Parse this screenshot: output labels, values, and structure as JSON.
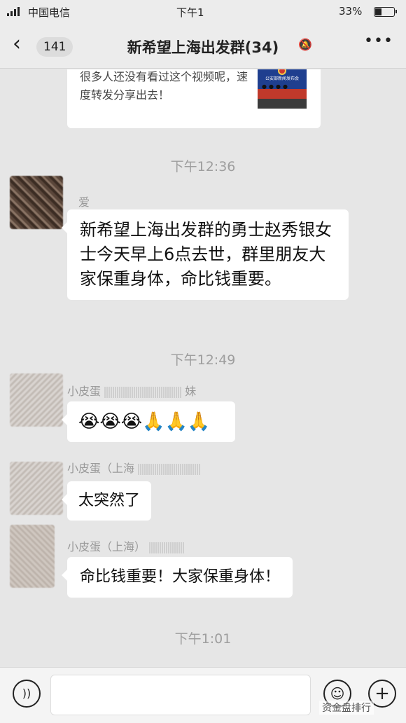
{
  "status_bar": {
    "carrier": "中国电信",
    "time": "下午1",
    "battery_pct": "33%",
    "battery_level": 0.33
  },
  "nav": {
    "back_count": "141",
    "title": "新希望上海出发群(34)"
  },
  "share_card": {
    "text": "很多人还没有看过这个视频呢，速度转发分享出去！",
    "thumb_caption": "公安部新闻发布会"
  },
  "messages": {
    "time1": "下午12:36",
    "sender1": "爱",
    "text1": "新希望上海出发群的勇士赵秀银女士今天早上6点去世，群里朋友大家保重身体，命比钱重要。",
    "time2": "下午12:49",
    "sender2": "小皮蛋",
    "sender2_suffix": "妹",
    "text2": "😭😭😭🙏🙏🙏",
    "sender3": "小皮蛋（上海",
    "text3": "太突然了",
    "sender4": "小皮蛋（上海）",
    "text4": "命比钱重要！大家保重身体！",
    "time3": "下午1:01"
  },
  "watermark": "资金盘排行",
  "icons": [
    "signal-icon",
    "battery-icon",
    "back-chevron-icon",
    "mute-bell-icon",
    "more-icon",
    "voice-icon",
    "emoji-icon",
    "plus-icon"
  ]
}
